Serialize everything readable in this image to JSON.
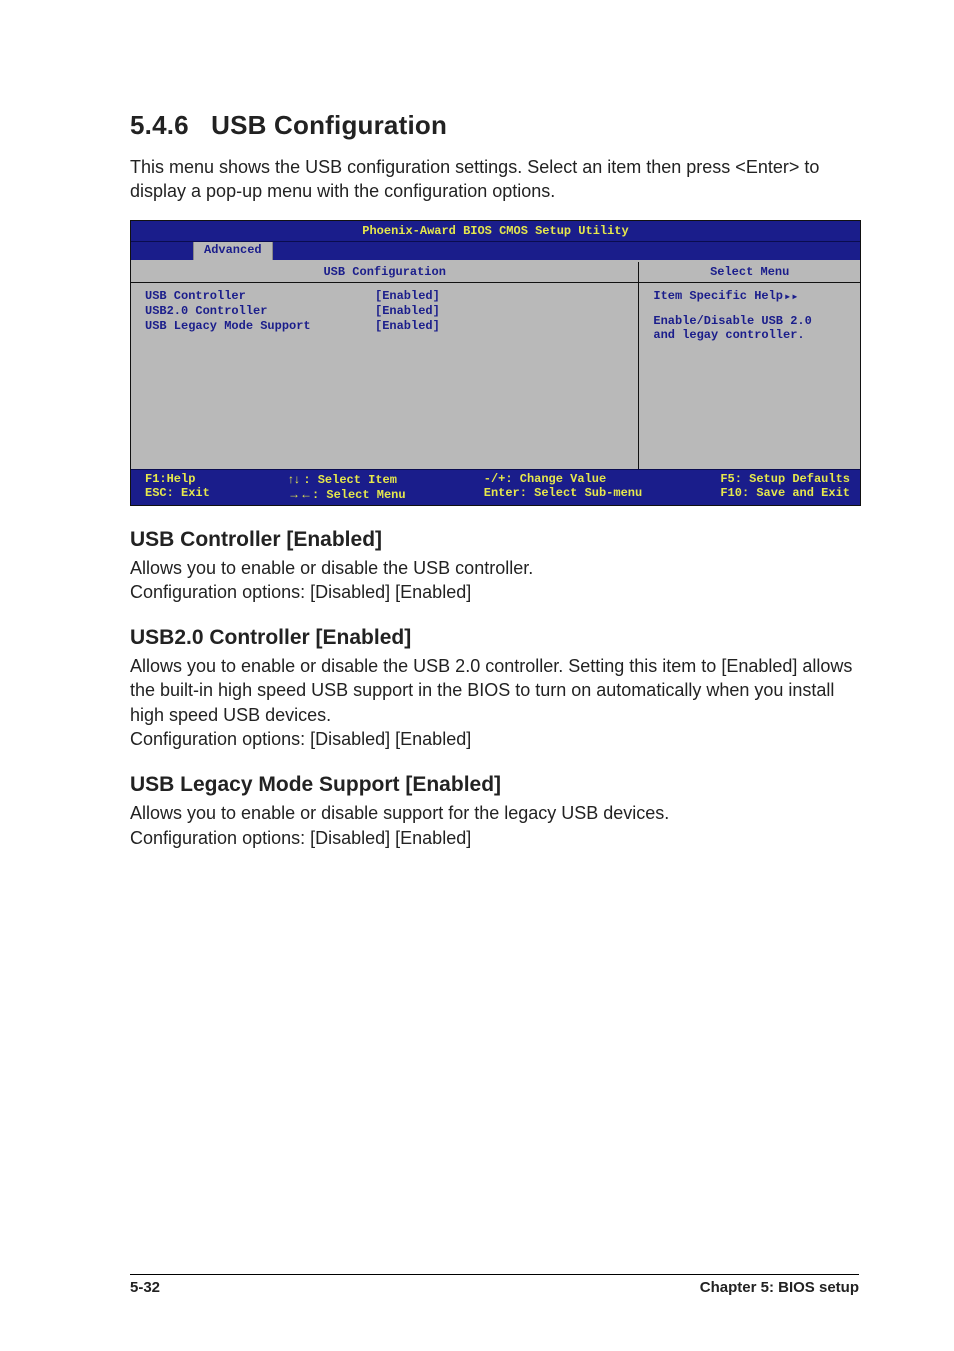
{
  "section": {
    "number": "5.4.6",
    "title": "USB Configuration",
    "intro": "This menu shows the USB configuration settings. Select an item then press <Enter> to display a pop-up menu with the configuration options."
  },
  "bios": {
    "titlebar": "Phoenix-Award BIOS CMOS Setup Utility",
    "active_tab": "Advanced",
    "main_header": "USB Configuration",
    "side_header": "Select Menu",
    "items": [
      {
        "label": "USB Controller",
        "value": "[Enabled]"
      },
      {
        "label": "USB2.0 Controller",
        "value": "[Enabled]"
      },
      {
        "label": "USB Legacy Mode Support",
        "value": "[Enabled]"
      }
    ],
    "help": {
      "title": "Item Specific Help",
      "arrows": "▸▸",
      "body1": "Enable/Disable USB 2.0",
      "body2": "and legay controller."
    },
    "footer": {
      "f1": "F1:Help",
      "esc": "ESC: Exit",
      "updown_label": ": Select Item",
      "leftright_label": ": Select Menu",
      "change": "-/+: Change Value",
      "enter": "Enter: Select Sub-menu",
      "f5": "F5: Setup Defaults",
      "f10": "F10: Save and Exit"
    }
  },
  "settings": [
    {
      "title": "USB Controller [Enabled]",
      "desc": "Allows you to enable or disable the USB controller.",
      "opts": "Configuration options: [Disabled] [Enabled]"
    },
    {
      "title": "USB2.0 Controller [Enabled]",
      "desc": "Allows you to enable or disable the USB 2.0 controller. Setting this item to [Enabled] allows the built-in high speed USB support in the BIOS to turn on automatically when you install high speed USB devices.",
      "opts": "Configuration options: [Disabled] [Enabled]"
    },
    {
      "title": "USB Legacy Mode Support [Enabled]",
      "desc": "Allows you to enable or disable support for the legacy USB devices.",
      "opts": "Configuration options: [Disabled] [Enabled]"
    }
  ],
  "page_footer": {
    "left": "5-32",
    "right": "Chapter 5: BIOS setup"
  }
}
